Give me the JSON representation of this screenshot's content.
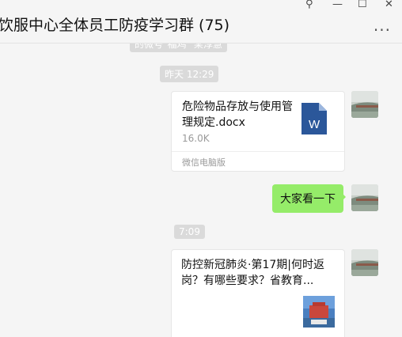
{
  "window": {
    "title": "饮服中心全体员工防疫学习群 (75)",
    "pin_glyph": "⚲",
    "minimize_glyph": "—",
    "maximize_glyph": "☐",
    "close_glyph": "✕",
    "more_glyph": "···"
  },
  "messages": {
    "clipped_system_notice": "的微号\"福鸡\" 某淳慧",
    "time_1": "昨天 12:29",
    "file_card": {
      "name": "危险物品存放与使用管理规定.docx",
      "size": "16.0K",
      "source": "微信电脑版",
      "icon_letter": "W"
    },
    "text_bubble": "大家看一下",
    "time_2": "7:09",
    "article_card": {
      "title": "防控新冠肺炎·第17期|何时返岗？有哪些要求？省教育..."
    }
  },
  "colors": {
    "bubble_green": "#95ec69",
    "word_blue": "#2b579a",
    "background": "#f5f5f5"
  }
}
